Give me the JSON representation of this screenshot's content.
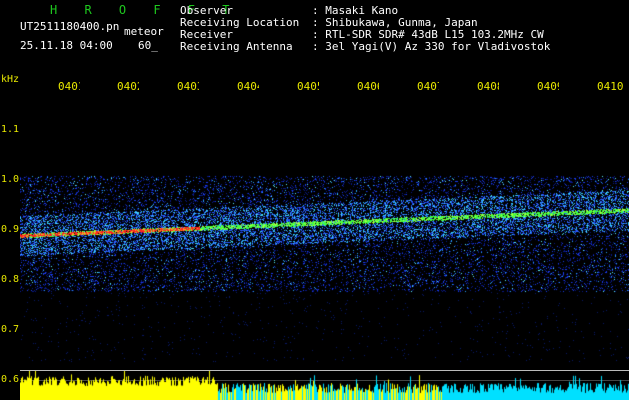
{
  "header": {
    "station": "H R O F F T",
    "file": "UT2511180400.pn",
    "meteor_label": "meteor",
    "date_time": "25.11.18 04:00",
    "count": "60_",
    "fields": [
      {
        "label": "Observer",
        "value": ": Masaki Kano"
      },
      {
        "label": "Receiving Location",
        "value": ": Shibukawa, Gunma, Japan"
      },
      {
        "label": "Receiver",
        "value": ": RTL-SDR SDR# 43dB L15 103.2MHz CW"
      },
      {
        "label": "Receiving Antenna",
        "value": ": 3el Yagi(V) Az 330 for Vladivostok"
      }
    ]
  },
  "axis": {
    "unit": "kHz",
    "freq_ticks": [
      "1.1",
      "1.0",
      "0.9",
      "0.8",
      "0.7",
      "0.6"
    ],
    "time_ticks": [
      "0401",
      "0402",
      "0403",
      "0404",
      "0405",
      "0406",
      "0407",
      "0408",
      "0409",
      "0410"
    ]
  },
  "colors": {
    "background": "#000000",
    "title_text": "#ffffff",
    "station_text": "#1ec81e",
    "axis_text": "#e8e800",
    "bar_early": "#ffff00",
    "bar_late": "#00e0ff",
    "trail": "#ff2020",
    "echo": "#40ff40"
  }
}
